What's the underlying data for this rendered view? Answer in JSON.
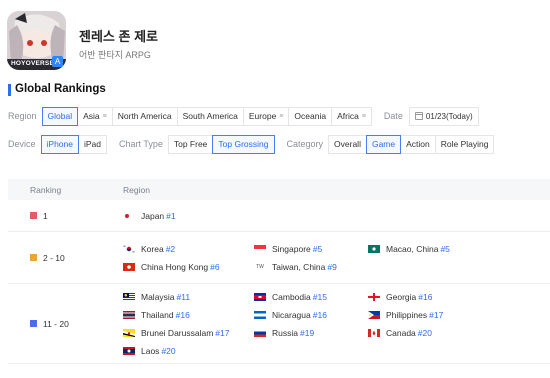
{
  "app": {
    "name": "젠레스 존 제로",
    "subtitle": "어반 판타지 ARPG",
    "icon_overlay_text": "HOYOVERSE",
    "store_badge_icon": "app-store-icon"
  },
  "section_title": "Global Rankings",
  "filters": {
    "region_label": "Region",
    "region_options": [
      {
        "label": "Global",
        "active": true,
        "menu": false
      },
      {
        "label": "Asia",
        "active": false,
        "menu": true
      },
      {
        "label": "North America",
        "active": false,
        "menu": false
      },
      {
        "label": "South America",
        "active": false,
        "menu": false
      },
      {
        "label": "Europe",
        "active": false,
        "menu": true
      },
      {
        "label": "Oceania",
        "active": false,
        "menu": false
      },
      {
        "label": "Africa",
        "active": false,
        "menu": true
      }
    ],
    "date_label": "Date",
    "date_value": "01/23(Today)",
    "device_label": "Device",
    "device_options": [
      {
        "label": "iPhone",
        "active": true
      },
      {
        "label": "iPad",
        "active": false
      }
    ],
    "chart_type_label": "Chart Type",
    "chart_type_options": [
      {
        "label": "Top Free",
        "active": false
      },
      {
        "label": "Top Grossing",
        "active": true
      }
    ],
    "category_label": "Category",
    "category_options": [
      {
        "label": "Overall",
        "active": false
      },
      {
        "label": "Game",
        "active": true
      },
      {
        "label": "Action",
        "active": false
      },
      {
        "label": "Role Playing",
        "active": false
      }
    ]
  },
  "table": {
    "col_ranking": "Ranking",
    "col_region": "Region",
    "rows": [
      {
        "rank": "1",
        "color": "#e45b67",
        "regions": [
          {
            "name": "Japan",
            "rank": "#1",
            "flag": "jp"
          }
        ]
      },
      {
        "rank": "2 - 10",
        "color": "#f0a23a",
        "regions": [
          {
            "name": "Korea",
            "rank": "#2",
            "flag": "kr"
          },
          {
            "name": "Singapore",
            "rank": "#5",
            "flag": "sg"
          },
          {
            "name": "Macao, China",
            "rank": "#5",
            "flag": "mo"
          },
          {
            "name": "China Hong Kong",
            "rank": "#6",
            "flag": "hk"
          },
          {
            "name": "Taiwan, China",
            "rank": "#9",
            "flag": "tw",
            "flag_text": "TW"
          }
        ]
      },
      {
        "rank": "11 - 20",
        "color": "#4a6df0",
        "regions": [
          {
            "name": "Malaysia",
            "rank": "#11",
            "flag": "my"
          },
          {
            "name": "Cambodia",
            "rank": "#15",
            "flag": "kh"
          },
          {
            "name": "Georgia",
            "rank": "#16",
            "flag": "ge"
          },
          {
            "name": "Thailand",
            "rank": "#16",
            "flag": "th"
          },
          {
            "name": "Nicaragua",
            "rank": "#16",
            "flag": "ni"
          },
          {
            "name": "Philippines",
            "rank": "#17",
            "flag": "ph"
          },
          {
            "name": "Brunei Darussalam",
            "rank": "#17",
            "flag": "bn"
          },
          {
            "name": "Russia",
            "rank": "#19",
            "flag": "ru"
          },
          {
            "name": "Canada",
            "rank": "#20",
            "flag": "ca"
          },
          {
            "name": "Laos",
            "rank": "#20",
            "flag": "la"
          }
        ]
      }
    ]
  }
}
